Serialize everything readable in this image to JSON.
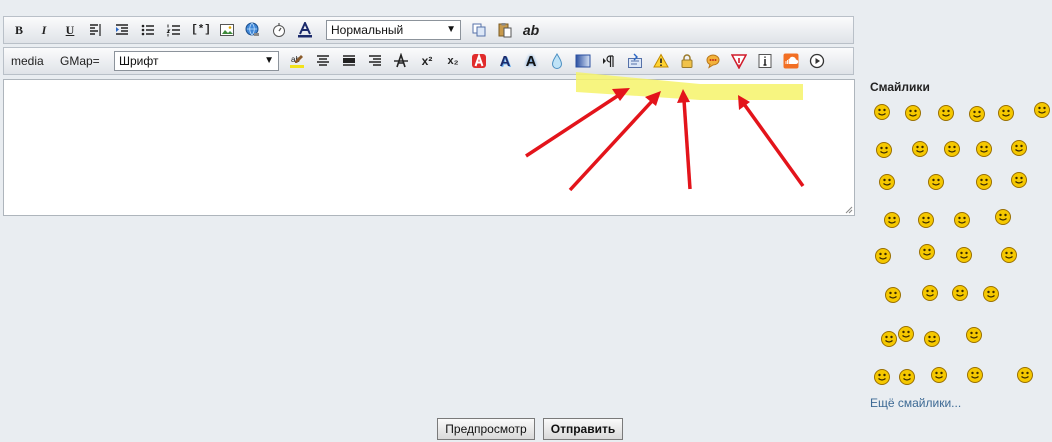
{
  "toolbar1": {
    "bold": "B",
    "italic": "I",
    "underline": "U",
    "code": "[*]",
    "format_select": "Нормальный",
    "ab": "ab"
  },
  "toolbar2": {
    "media": "media",
    "gmap": "GMap=",
    "font_select": "Шрифт",
    "superscript": "x²",
    "subscript": "x₂",
    "font_a": "A"
  },
  "smilies": {
    "title": "Смайлики",
    "more": "Ещё смайлики..."
  },
  "buttons": {
    "preview": "Предпросмотр",
    "submit": "Отправить"
  },
  "colors": {
    "highlight": "#f6f36a",
    "arrow": "#e3141b",
    "smiley": "#f5c800"
  }
}
